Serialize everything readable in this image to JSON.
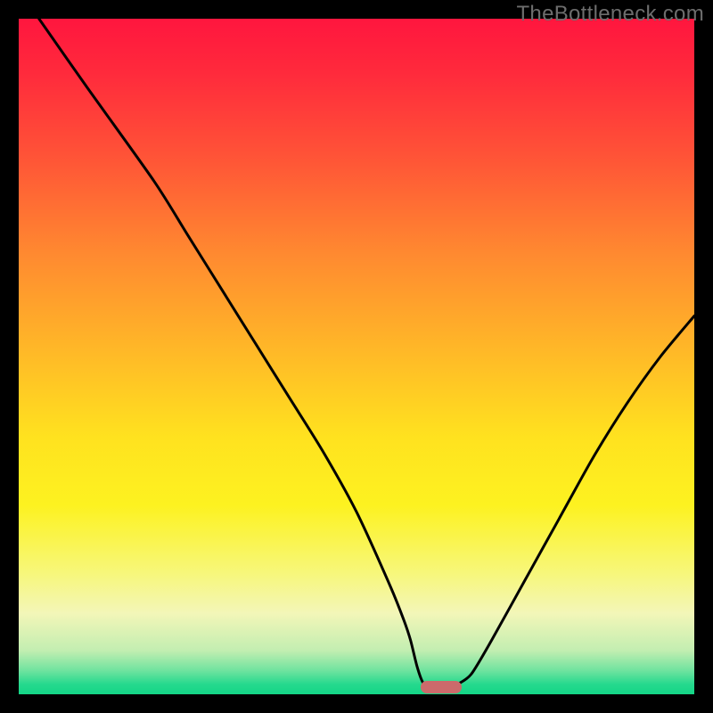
{
  "watermark": "TheBottleneck.com",
  "colors": {
    "frame": "#000000",
    "gradient_stops": [
      {
        "offset": 0.0,
        "color": "#ff163e"
      },
      {
        "offset": 0.08,
        "color": "#ff2a3c"
      },
      {
        "offset": 0.2,
        "color": "#ff5237"
      },
      {
        "offset": 0.35,
        "color": "#ff8a30"
      },
      {
        "offset": 0.5,
        "color": "#ffbb27"
      },
      {
        "offset": 0.62,
        "color": "#ffe21f"
      },
      {
        "offset": 0.72,
        "color": "#fdf220"
      },
      {
        "offset": 0.82,
        "color": "#f7f77a"
      },
      {
        "offset": 0.88,
        "color": "#f3f6b8"
      },
      {
        "offset": 0.935,
        "color": "#c3eeb1"
      },
      {
        "offset": 0.965,
        "color": "#6fe39f"
      },
      {
        "offset": 0.985,
        "color": "#26d98e"
      },
      {
        "offset": 1.0,
        "color": "#13d586"
      }
    ],
    "curve": "#000000",
    "marker": "#cc6a6b",
    "watermark": "#6d6d6d"
  },
  "chart_data": {
    "type": "line",
    "title": "",
    "xlabel": "",
    "ylabel": "",
    "xlim": [
      0,
      100
    ],
    "ylim": [
      0,
      100
    ],
    "x": [
      3,
      10,
      20,
      25,
      30,
      35,
      40,
      45,
      50,
      55,
      57,
      58,
      59,
      60,
      62,
      64,
      65,
      67,
      70,
      75,
      80,
      85,
      90,
      95,
      100
    ],
    "values": [
      100,
      90,
      76,
      68,
      60,
      52,
      44,
      36,
      27,
      16,
      11,
      8,
      4,
      1.5,
      1,
      1,
      1.5,
      3,
      8,
      17,
      26,
      35,
      43,
      50,
      56
    ],
    "flat_segment": {
      "x_start": 60,
      "x_end": 65,
      "y": 1
    },
    "marker": {
      "x_center": 62.5,
      "y": 1,
      "width_pct": 6
    }
  }
}
